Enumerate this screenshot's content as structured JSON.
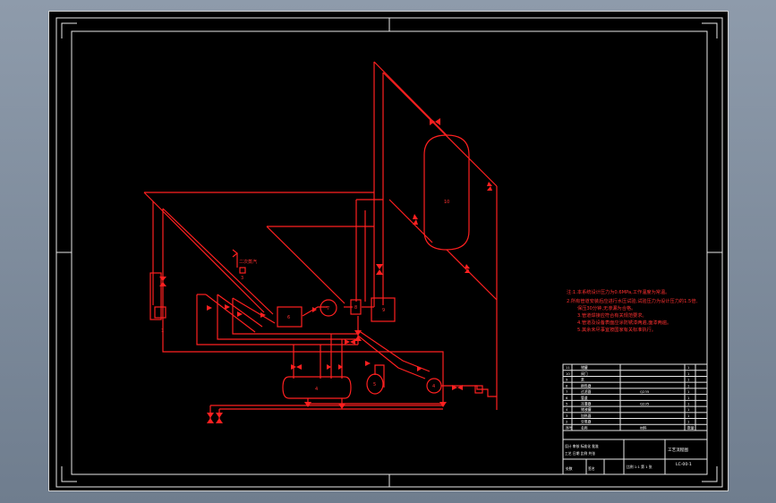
{
  "colors": {
    "background": "#7f8c9c",
    "sheet": "#000000",
    "piping": "#ff2020",
    "frame": "#e8e8e8"
  },
  "drawing": {
    "equipment_tags": {
      "storage_tank": "10",
      "heat_exchanger": "4",
      "unit_5": "5",
      "pump_7": "7",
      "pump_4": "4",
      "pump_6": "6",
      "box_8": "8",
      "box_9": "9",
      "filter": "1",
      "small_box": "3"
    },
    "stream_label": "二次蒸汽",
    "notes": [
      "注:1.本系统设计压力为0.6MPa,工作温度为常温。",
      "2.所有管道安装后应进行水压试验,试验压力为设计压力的1.5倍,",
      "保压30分钟,无渗漏为合格。",
      "3.管道焊接应符合有关规范要求。",
      "4.管道及设备表面应涂防锈漆两遍,面漆两遍。",
      "5.其余未尽事宜按国家有关标准执行。"
    ]
  },
  "title_block": {
    "parts_table": [
      [
        "11",
        "储罐",
        "",
        "1"
      ],
      [
        "10",
        "阀门",
        "",
        "1"
      ],
      [
        "9",
        "泵",
        "",
        "1"
      ],
      [
        "8",
        "换热器",
        "",
        "1"
      ],
      [
        "7",
        "过滤器",
        "Q235",
        "1"
      ],
      [
        "6",
        "管道",
        "",
        "1"
      ],
      [
        "5",
        "冷凝器",
        "Q235",
        "1"
      ],
      [
        "4",
        "储液罐",
        "",
        "1"
      ],
      [
        "3",
        "加热器",
        "",
        "1"
      ],
      [
        "2",
        "分离器",
        "",
        "1"
      ],
      [
        "序号",
        "名称",
        "材料",
        "数量"
      ]
    ],
    "drawing_title": "工艺流程图",
    "drawing_number": "LC-00-1",
    "sign_rows": [
      "设计 审核 标准化 批准",
      "工艺 日期 比例 共张"
    ],
    "scale_row": "比例 1:1 第 1 张",
    "bottom_cells": [
      "处数",
      "签名"
    ]
  }
}
